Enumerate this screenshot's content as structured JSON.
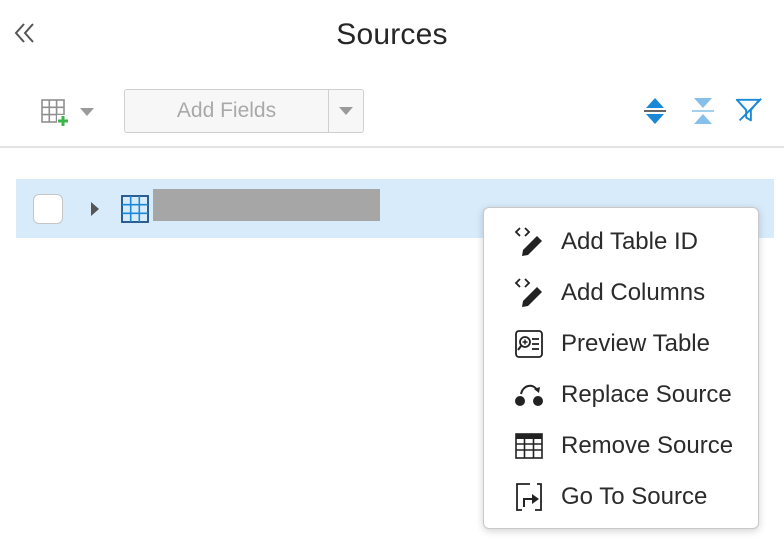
{
  "header": {
    "title": "Sources"
  },
  "toolbar": {
    "add_fields_label": "Add Fields"
  },
  "colors": {
    "accent_blue": "#1a88d6",
    "accent_blue_light": "#86c0ea",
    "plus_green": "#3cb54a",
    "row_selected": "#d7ebfb"
  },
  "icons": {
    "collapse": "double-chevron-left-icon",
    "add_table": "table-add-icon",
    "expand_all": "expand-all-icon",
    "collapse_all": "collapse-all-icon",
    "filter": "filter-icon"
  },
  "tree": {
    "rows": [
      {
        "checked": false,
        "expanded": false,
        "name_redacted": true
      }
    ]
  },
  "context_menu": {
    "items": [
      {
        "label": "Add Table ID",
        "icon": "code-edit-icon"
      },
      {
        "label": "Add Columns",
        "icon": "code-edit-icon"
      },
      {
        "label": "Preview Table",
        "icon": "preview-table-icon"
      },
      {
        "label": "Replace Source",
        "icon": "replace-source-icon"
      },
      {
        "label": "Remove Source",
        "icon": "remove-source-icon"
      },
      {
        "label": "Go To Source",
        "icon": "go-to-source-icon"
      }
    ]
  }
}
